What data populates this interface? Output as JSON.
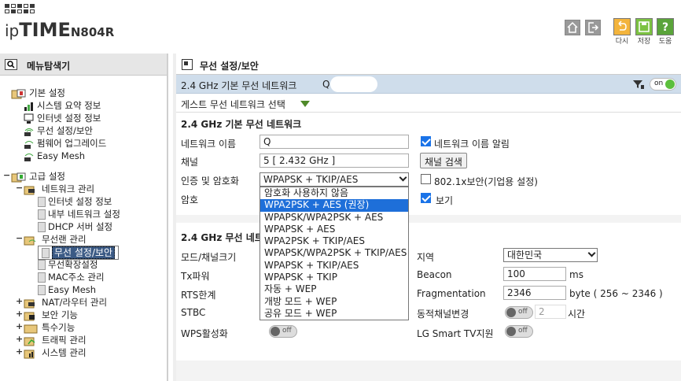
{
  "header": {
    "brand_ip": "ip",
    "brand_time": "TIME",
    "brand_model": "N804R",
    "buttons": [
      {
        "label": "다시",
        "icon": "undo-icon"
      },
      {
        "label": "저장",
        "icon": "save-icon"
      },
      {
        "label": "도움",
        "icon": "help-icon"
      }
    ]
  },
  "sidebar": {
    "title": "메뉴탐색기",
    "basic": {
      "label": "기본 설정",
      "items": [
        "시스템 요약 정보",
        "인터넷 설정 정보",
        "무선 설정/보안",
        "펌웨어 업그레이드",
        "Easy Mesh"
      ]
    },
    "advanced": {
      "label": "고급 설정",
      "network": {
        "label": "네트워크 관리",
        "items": [
          "인터넷 설정 정보",
          "내부 네트워크 설정",
          "DHCP 서버 설정"
        ]
      },
      "wireless": {
        "label": "무선랜 관리",
        "items": [
          "무선 설정/보안",
          "무선확장설정",
          "MAC주소 관리",
          "Easy Mesh"
        ]
      },
      "others": [
        "NAT/라우터 관리",
        "보안 기능",
        "특수기능",
        "트래픽 관리",
        "시스템 관리"
      ]
    }
  },
  "main": {
    "title": "무선 설정/보안",
    "network_bar": {
      "label": "2.4 GHz 기본 무선 네트워크",
      "ssid": "Q",
      "toggle": "on"
    },
    "guest_label": "게스트 무선 네트워크 선택",
    "basic_section": {
      "title": "2.4 GHz 기본 무선 네트워크",
      "network_name_label": "네트워크 이름",
      "network_name_value": "Q",
      "broadcast_label": "네트워크 이름 알림",
      "channel_label": "채널",
      "channel_value": "5 [ 2.432 GHz ]",
      "channel_search": "채널 검색",
      "auth_label": "인증 및 암호화",
      "auth_value": "WPAPSK + TKIP/AES",
      "enterprise_label": "802.1x보안(기업용 설정)",
      "password_label": "암호",
      "show_label": "보기"
    },
    "advanced_section": {
      "title": "2.4 GHz 무선 네트",
      "mode_label": "모드/채널크기",
      "region_label": "지역",
      "region_value": "대한민국",
      "tx_label": "Tx파워",
      "beacon_label": "Beacon",
      "beacon_value": "100",
      "beacon_unit": "ms",
      "rts_label": "RTS한계",
      "fragmentation_label": "Fragmentation",
      "fragmentation_value": "2346",
      "fragmentation_unit": "byte ( 256 ~ 2346 )",
      "stbc_label": "STBC",
      "dynamic_label": "동적채널변경",
      "dynamic_value": "2",
      "dynamic_unit": "시간",
      "wps_label": "WPS활성화",
      "lg_label": "LG Smart TV지원",
      "off_text": "off"
    },
    "auth_options": [
      "암호화 사용하지 않음",
      "WPA2PSK + AES (권장)",
      "WPAPSK/WPA2PSK + AES",
      "WPAPSK + AES",
      "WPA2PSK + TKIP/AES",
      "WPAPSK/WPA2PSK + TKIP/AES",
      "WPAPSK + TKIP/AES",
      "WPAPSK + TKIP",
      "자동 + WEP",
      "개방 모드 + WEP",
      "공유 모드 + WEP"
    ],
    "highlighted_option_index": 1
  }
}
